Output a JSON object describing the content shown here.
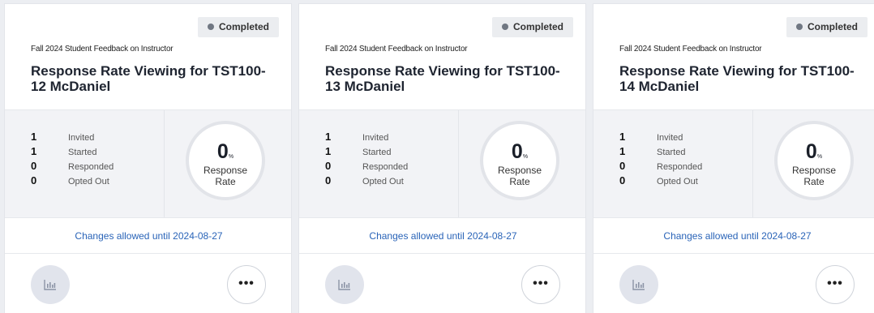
{
  "cards": [
    {
      "status": "Completed",
      "subtitle": "Fall 2024 Student Feedback on Instructor",
      "title": "Response Rate Viewing for TST100-12 McDaniel",
      "stats": [
        {
          "value": "1",
          "label": "Invited"
        },
        {
          "value": "1",
          "label": "Started"
        },
        {
          "value": "0",
          "label": "Responded"
        },
        {
          "value": "0",
          "label": "Opted Out"
        }
      ],
      "rate_value": "0",
      "rate_unit": "%",
      "rate_label_1": "Response",
      "rate_label_2": "Rate",
      "changes": "Changes allowed until 2024-08-27",
      "more_label": "•••"
    },
    {
      "status": "Completed",
      "subtitle": "Fall 2024 Student Feedback on Instructor",
      "title": "Response Rate Viewing for TST100-13 McDaniel",
      "stats": [
        {
          "value": "1",
          "label": "Invited"
        },
        {
          "value": "1",
          "label": "Started"
        },
        {
          "value": "0",
          "label": "Responded"
        },
        {
          "value": "0",
          "label": "Opted Out"
        }
      ],
      "rate_value": "0",
      "rate_unit": "%",
      "rate_label_1": "Response",
      "rate_label_2": "Rate",
      "changes": "Changes allowed until 2024-08-27",
      "more_label": "•••"
    },
    {
      "status": "Completed",
      "subtitle": "Fall 2024 Student Feedback on Instructor",
      "title": "Response Rate Viewing for TST100-14 McDaniel",
      "stats": [
        {
          "value": "1",
          "label": "Invited"
        },
        {
          "value": "1",
          "label": "Started"
        },
        {
          "value": "0",
          "label": "Responded"
        },
        {
          "value": "0",
          "label": "Opted Out"
        }
      ],
      "rate_value": "0",
      "rate_unit": "%",
      "rate_label_1": "Response",
      "rate_label_2": "Rate",
      "changes": "Changes allowed until 2024-08-27",
      "more_label": "•••"
    }
  ],
  "icons": {
    "report": "bar-chart-icon",
    "more": "more-horizontal-icon",
    "status": "status-dot-icon"
  },
  "colors": {
    "link": "#2a64b8",
    "badge_bg": "#ebedf0",
    "stats_bg": "#f2f3f6"
  }
}
